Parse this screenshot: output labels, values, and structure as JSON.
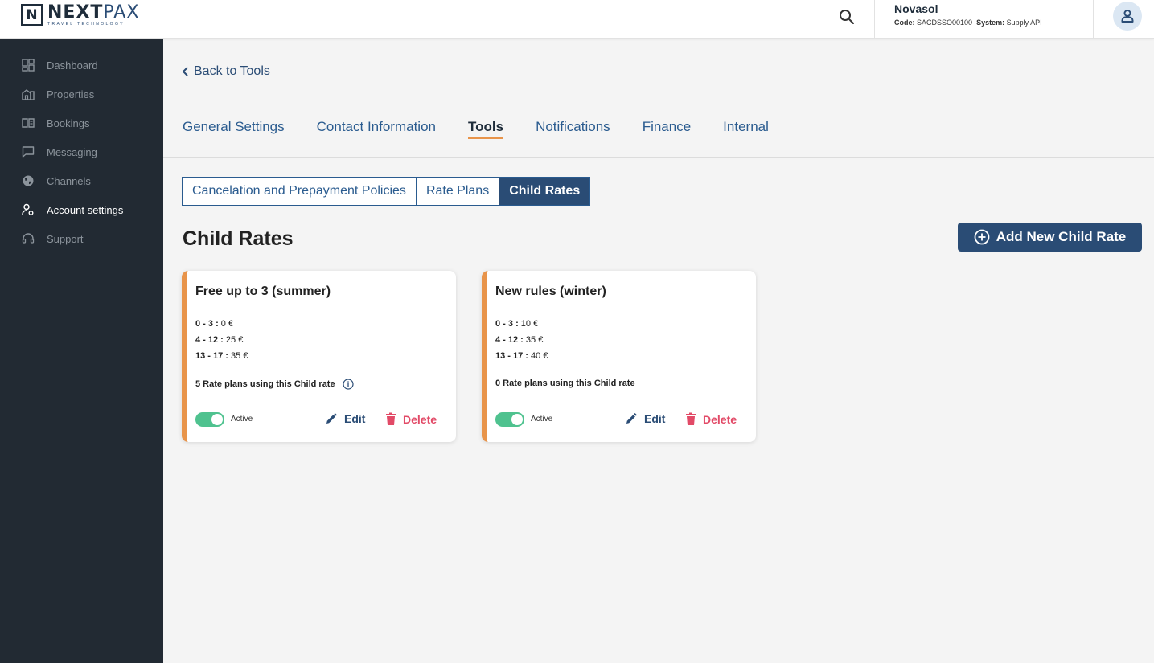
{
  "header": {
    "logo_mark": "N",
    "logo_bold": "NEXT",
    "logo_thin": "PAX",
    "logo_sub": "TRAVEL TECHNOLOGY",
    "search_icon": "search-icon",
    "account": {
      "name": "Novasol",
      "code_label": "Code:",
      "code": "SACDSSO00100",
      "system_label": "System:",
      "system": "Supply API"
    },
    "avatar_icon": "user-icon"
  },
  "sidebar": {
    "items": [
      {
        "label": "Dashboard",
        "icon": "dashboard-icon"
      },
      {
        "label": "Properties",
        "icon": "properties-icon"
      },
      {
        "label": "Bookings",
        "icon": "bookings-icon"
      },
      {
        "label": "Messaging",
        "icon": "messaging-icon"
      },
      {
        "label": "Channels",
        "icon": "globe-icon"
      },
      {
        "label": "Account settings",
        "icon": "account-settings-icon"
      },
      {
        "label": "Support",
        "icon": "support-icon"
      }
    ],
    "active_index": 5
  },
  "main": {
    "back_label": "Back to Tools",
    "tabs": [
      {
        "label": "General Settings"
      },
      {
        "label": "Contact Information"
      },
      {
        "label": "Tools"
      },
      {
        "label": "Notifications"
      },
      {
        "label": "Finance"
      },
      {
        "label": "Internal"
      }
    ],
    "active_tab": "Tools",
    "subtabs": [
      {
        "label": "Cancelation and Prepayment Policies"
      },
      {
        "label": "Rate Plans"
      },
      {
        "label": "Child Rates"
      }
    ],
    "active_subtab": "Child Rates",
    "title": "Child Rates",
    "add_button": "Add New Child Rate",
    "cards": [
      {
        "title": "Free up to 3 (summer)",
        "rates": [
          {
            "range": "0 - 3 :",
            "price": "0 €"
          },
          {
            "range": "4 - 12 :",
            "price": "25 €"
          },
          {
            "range": "13 - 17 :",
            "price": "35 €"
          }
        ],
        "usage": "5 Rate plans using this Child rate",
        "has_info": true,
        "active": true,
        "active_label": "Active",
        "edit": "Edit",
        "delete": "Delete"
      },
      {
        "title": "New rules (winter)",
        "rates": [
          {
            "range": "0 - 3 :",
            "price": "10 €"
          },
          {
            "range": "4 - 12 :",
            "price": "35 €"
          },
          {
            "range": "13 - 17 :",
            "price": "40 €"
          }
        ],
        "usage": "0 Rate plans using this Child rate",
        "has_info": false,
        "active": true,
        "active_label": "Active",
        "edit": "Edit",
        "delete": "Delete"
      }
    ]
  },
  "colors": {
    "sidebar_bg": "#222a33",
    "primary": "#2a4c75",
    "accent": "#e8944a",
    "toggle_on": "#4fc28f",
    "danger": "#e24a67"
  }
}
